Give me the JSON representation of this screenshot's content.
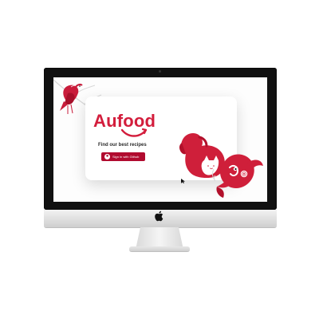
{
  "app": {
    "logo_text": "Aufood",
    "tagline": "Find our best recipes",
    "signin_button_label": "Sign in with Github"
  },
  "icons": {
    "apple_logo": "apple-logo-icon",
    "github": "github-icon"
  },
  "colors": {
    "brand_red": "#d31d3c",
    "button_red": "#b10b2f"
  }
}
